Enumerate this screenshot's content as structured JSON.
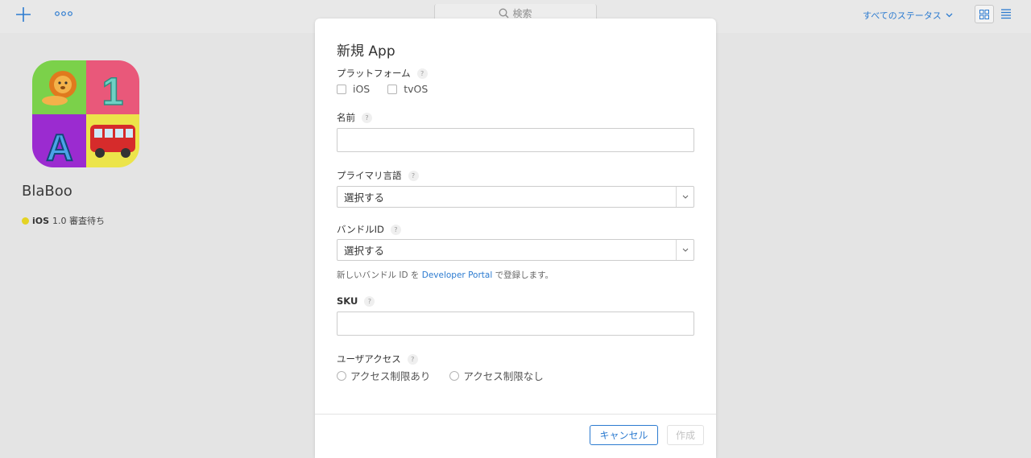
{
  "toolbar": {
    "search_placeholder": "検索",
    "status_filter": "すべてのステータス"
  },
  "app": {
    "name": "BlaBoo",
    "platform": "iOS",
    "version_status": "1.0 審査待ち",
    "icon_letters": {
      "number": "1",
      "letter": "A"
    }
  },
  "modal": {
    "title": "新規 App",
    "help_glyph": "?",
    "platform": {
      "label": "プラットフォーム",
      "options": [
        "iOS",
        "tvOS"
      ]
    },
    "name": {
      "label": "名前",
      "value": ""
    },
    "primary_language": {
      "label": "プライマリ言語",
      "selected": "選択する"
    },
    "bundle_id": {
      "label": "バンドルID",
      "selected": "選択する",
      "hint_prefix": "新しいバンドル ID を",
      "hint_link": "Developer Portal",
      "hint_suffix": "で登録します。"
    },
    "sku": {
      "label": "SKU",
      "value": ""
    },
    "user_access": {
      "label": "ユーザアクセス",
      "options": [
        "アクセス制限あり",
        "アクセス制限なし"
      ]
    },
    "buttons": {
      "cancel": "キャンセル",
      "create": "作成"
    }
  },
  "colors": {
    "accent": "#2c7bd0",
    "status_pending": "#e4d323",
    "tile_green": "#7bd14a",
    "tile_pink": "#e9587a",
    "tile_purple": "#9b2bd0",
    "tile_yellow": "#ece44a"
  }
}
